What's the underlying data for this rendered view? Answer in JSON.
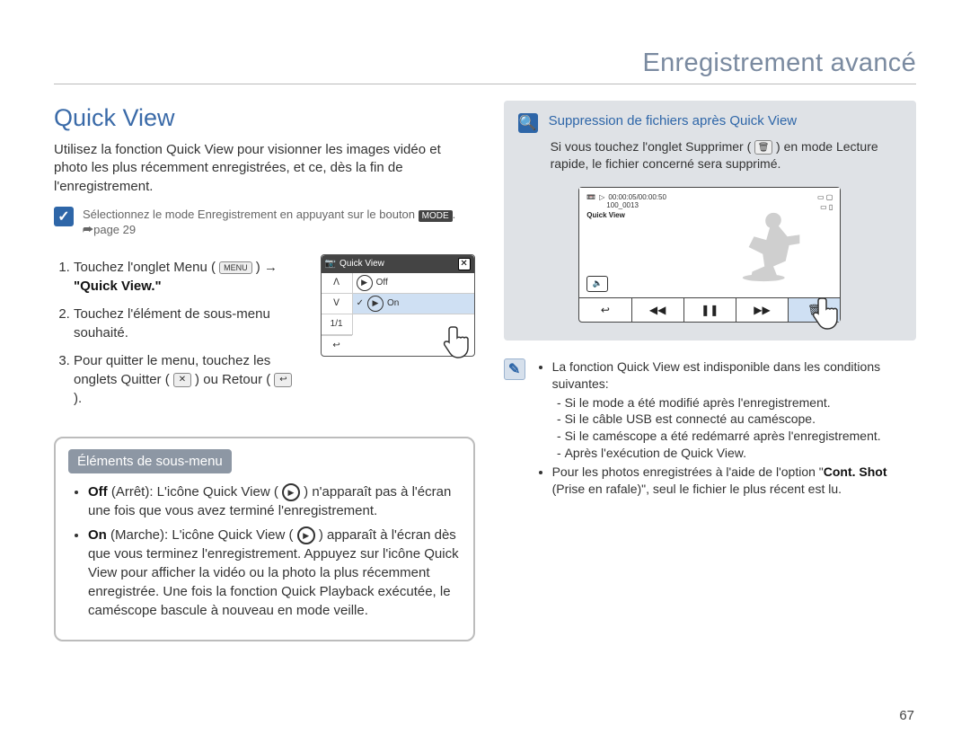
{
  "header": {
    "title": "Enregistrement avancé"
  },
  "page_number": "67",
  "left": {
    "heading": "Quick View",
    "intro": "Utilisez la fonction Quick View pour visionner les images vidéo et photo les plus récemment enregistrées, et ce, dès la fin de l'enregistrement.",
    "tip": {
      "pre": "Sélectionnez le mode Enregistrement en appuyant sur le bouton ",
      "mode": "MODE",
      "post": ". ⮫page 29"
    },
    "steps": {
      "s1a": "Touchez l'onglet Menu ( ",
      "s1_menu": "MENU",
      "s1b": " ) → ",
      "s1_qv": "\"Quick View.\"",
      "s2": "Touchez l'élément de sous-menu souhaité.",
      "s3a": "Pour quitter le menu, touchez les onglets Quitter ( ",
      "s3b": " ) ou Retour ( ",
      "s3c": " )."
    },
    "ui": {
      "title": "Quick View",
      "off": "Off",
      "on": "On",
      "counter": "1/1"
    },
    "submenu": {
      "tab": "Éléments de sous-menu",
      "off_b": "Off",
      "off_p": " (Arrêt): L'icône Quick View ( ",
      "off_t": " ) n'apparaît pas à l'écran une fois que vous avez terminé l'enregistrement.",
      "on_b": "On",
      "on_p": " (Marche): L'icône Quick View ( ",
      "on_t": " ) apparaît à l'écran dès que vous terminez l'enregistrement. Appuyez sur l'icône Quick View pour afficher la vidéo ou la photo la plus récemment enregistrée. Une fois la fonction Quick Playback exécutée, le caméscope bascule à nouveau en mode veille."
    }
  },
  "right": {
    "box_title": "Suppression de fichiers après Quick View",
    "box_text_a": "Si vous touchez l'onglet Supprimer ( ",
    "box_text_b": " ) en mode Lecture rapide, le fichier concerné sera supprimé.",
    "player": {
      "time": "00:00:05/00:00:50",
      "file": "100_0013",
      "label": "Quick View"
    },
    "note": {
      "n1": "La fonction Quick View est indisponible dans les conditions suivantes:",
      "n1a": "Si le mode a été modifié après l'enregistrement.",
      "n1b": "Si le câble USB est connecté au caméscope.",
      "n1c": "Si le caméscope a été redémarré après l'enregistrement.",
      "n1d": "Après l'exécution de Quick View.",
      "n2a": "Pour les photos enregistrées à l'aide de l'option \"",
      "n2b": "Cont. Shot",
      "n2c": " (Prise en rafale)\", seul le fichier le plus récent est lu."
    }
  }
}
